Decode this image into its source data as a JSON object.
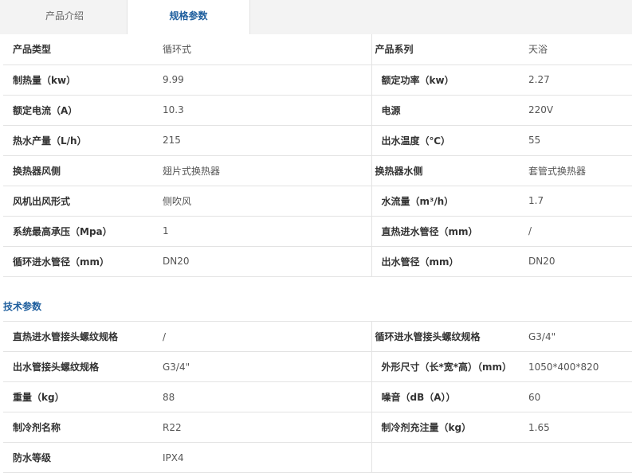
{
  "tabs": [
    {
      "label": "产品介绍"
    },
    {
      "label": "规格参数"
    }
  ],
  "spec_table": [
    [
      "产品类型",
      "循环式",
      "产品系列",
      "天浴"
    ],
    [
      "制热量（kw）",
      "9.99",
      "额定功率（kw）",
      "2.27"
    ],
    [
      "额定电流（A）",
      "10.3",
      "电源",
      "220V"
    ],
    [
      "热水产量（L/h）",
      "215",
      "出水温度（℃）",
      "55"
    ],
    [
      "换热器风侧",
      "翅片式换热器",
      "换热器水侧",
      "套管式换热器"
    ],
    [
      "风机出风形式",
      "侧吹风",
      "水流量（m³/h）",
      "1.7"
    ],
    [
      "系统最高承压（Mpa）",
      "1",
      "直热进水管径（mm）",
      "/"
    ],
    [
      "循环进水管径（mm）",
      "DN20",
      "出水管径（mm）",
      "DN20"
    ]
  ],
  "tech_title": "技术参数",
  "tech_table": [
    [
      "直热进水管接头螺纹规格",
      "/",
      "循环进水管接头螺纹规格",
      "G3/4\""
    ],
    [
      "出水管接头螺纹规格",
      "G3/4\"",
      "外形尺寸（长*宽*高）（mm）",
      "1050*400*820"
    ],
    [
      "重量（kg）",
      "88",
      "噪音（dB（A））",
      "60"
    ],
    [
      "制冷剂名称",
      "R22",
      "制冷剂充注量（kg）",
      "1.65"
    ],
    [
      "防水等级",
      "IPX4",
      "",
      ""
    ]
  ],
  "colors": {
    "accent": "#1f5f9e",
    "tab_bg": "#f3f3f3",
    "border": "#e3e3e3"
  }
}
